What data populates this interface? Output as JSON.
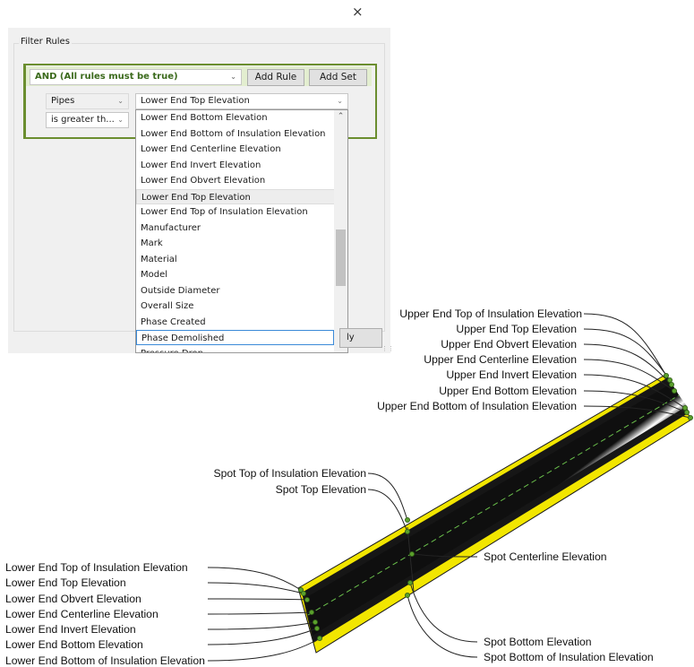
{
  "dialog": {
    "close_glyph": "×",
    "filter_rules_title": "Filter Rules",
    "and_set": {
      "label": "AND (All rules must be true)"
    },
    "add_rule_label": "Add Rule",
    "add_set_label": "Add Set",
    "rule": {
      "category": "Pipes",
      "parameter": "Lower End Top Elevation",
      "operator": "is greater th..."
    },
    "dropdown_items": [
      "Lower End Bottom Elevation",
      "Lower End Bottom of Insulation Elevation",
      "Lower End Centerline Elevation",
      "Lower End Invert Elevation",
      "Lower End Obvert Elevation",
      "Lower End Top Elevation",
      "Lower End Top of Insulation Elevation",
      "Manufacturer",
      "Mark",
      "Material",
      "Model",
      "Outside Diameter",
      "Overall Size",
      "Phase Created",
      "Phase Demolished",
      "Pressure Drop"
    ],
    "hovered_item": "Lower End Top Elevation",
    "selected_item": "Phase Demolished",
    "apply_partial_label": "ly"
  },
  "diagram": {
    "upper_labels": [
      "Upper End Top of Insulation Elevation",
      "Upper End Top Elevation",
      "Upper End Obvert Elevation",
      "Upper End Centerline Elevation",
      "Upper End Invert Elevation",
      "Upper End Bottom Elevation",
      "Upper End Bottom of Insulation Elevation"
    ],
    "spot_top_labels": [
      "Spot Top of Insulation Elevation",
      "Spot Top Elevation"
    ],
    "spot_centerline_label": "Spot Centerline Elevation",
    "spot_bottom_labels": [
      "Spot Bottom Elevation",
      "Spot Bottom of Insulation Elevation"
    ],
    "lower_labels": [
      "Lower End Top of Insulation Elevation",
      "Lower End Top Elevation",
      "Lower End Obvert Elevation",
      "Lower End Centerline Elevation",
      "Lower End  Invert Elevation",
      "Lower End Bottom Elevation",
      "Lower End Bottom of Insulation Elevation"
    ],
    "colors": {
      "insulation": "#f2e600",
      "pipe_dark": "#1a1a1a",
      "point": "#5aa02c",
      "centerline": "#6abf4b",
      "ui_green": "#6b8e2f"
    }
  }
}
